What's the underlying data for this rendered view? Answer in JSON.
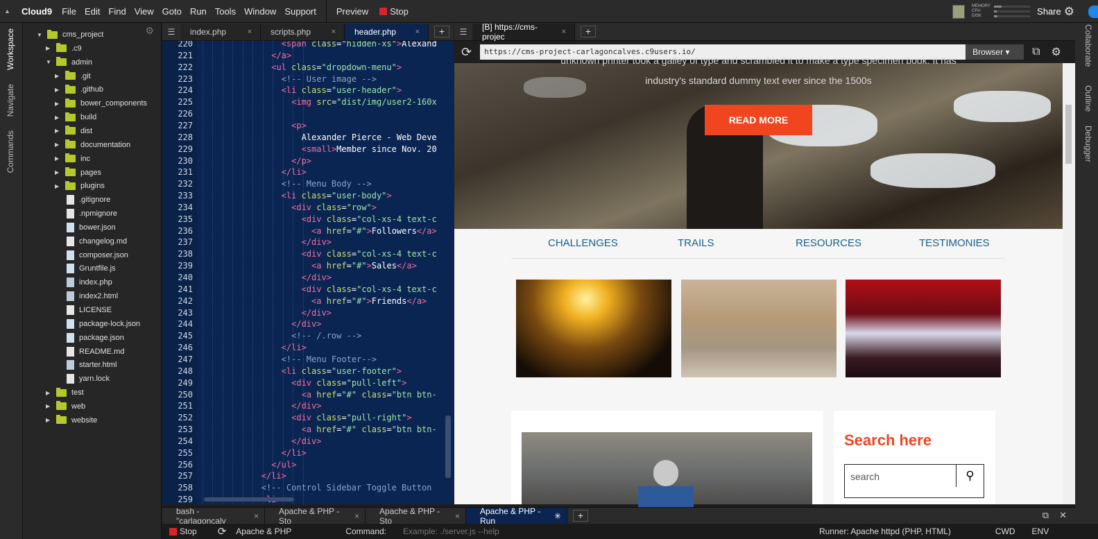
{
  "menubar": {
    "logo": "Cloud9",
    "items": [
      "File",
      "Edit",
      "Find",
      "View",
      "Goto",
      "Run",
      "Tools",
      "Window",
      "Support"
    ],
    "preview": "Preview",
    "stop": "Stop",
    "share": "Share",
    "meters": [
      "MEMORY",
      "CPU",
      "DISK"
    ],
    "meter_levels": [
      0.22,
      0.08,
      0.1
    ]
  },
  "left_side_tabs": [
    "Workspace",
    "Navigate",
    "Commands"
  ],
  "right_side_tabs": [
    "Collaborate",
    "Outline",
    "Debugger"
  ],
  "tree": [
    {
      "name": "cms_project",
      "kind": "folder",
      "open": true,
      "level": 0
    },
    {
      "name": ".c9",
      "kind": "folder",
      "open": false,
      "level": 1
    },
    {
      "name": "admin",
      "kind": "folder",
      "open": true,
      "level": 1
    },
    {
      "name": ".git",
      "kind": "folder",
      "open": false,
      "level": 2
    },
    {
      "name": ".github",
      "kind": "folder",
      "open": false,
      "level": 2
    },
    {
      "name": "bower_components",
      "kind": "folder",
      "open": false,
      "level": 2
    },
    {
      "name": "build",
      "kind": "folder",
      "open": false,
      "level": 2
    },
    {
      "name": "dist",
      "kind": "folder",
      "open": false,
      "level": 2
    },
    {
      "name": "documentation",
      "kind": "folder",
      "open": false,
      "level": 2
    },
    {
      "name": "inc",
      "kind": "folder",
      "open": false,
      "level": 2
    },
    {
      "name": "pages",
      "kind": "folder",
      "open": false,
      "level": 2
    },
    {
      "name": "plugins",
      "kind": "folder",
      "open": false,
      "level": 2
    },
    {
      "name": ".gitignore",
      "kind": "file",
      "level": 2
    },
    {
      "name": ".npmignore",
      "kind": "file",
      "level": 2
    },
    {
      "name": "bower.json",
      "kind": "js",
      "level": 2
    },
    {
      "name": "changelog.md",
      "kind": "file",
      "level": 2
    },
    {
      "name": "composer.json",
      "kind": "js",
      "level": 2
    },
    {
      "name": "Gruntfile.js",
      "kind": "js",
      "level": 2
    },
    {
      "name": "index.php",
      "kind": "html",
      "level": 2
    },
    {
      "name": "index2.html",
      "kind": "html",
      "level": 2
    },
    {
      "name": "LICENSE",
      "kind": "file",
      "level": 2
    },
    {
      "name": "package-lock.json",
      "kind": "js",
      "level": 2
    },
    {
      "name": "package.json",
      "kind": "js",
      "level": 2
    },
    {
      "name": "README.md",
      "kind": "file",
      "level": 2
    },
    {
      "name": "starter.html",
      "kind": "html",
      "level": 2
    },
    {
      "name": "yarn.lock",
      "kind": "file",
      "level": 2
    },
    {
      "name": "test",
      "kind": "folder",
      "open": false,
      "level": 1
    },
    {
      "name": "web",
      "kind": "folder",
      "open": false,
      "level": 1
    },
    {
      "name": "website",
      "kind": "folder",
      "open": false,
      "level": 1
    }
  ],
  "editor_tabs": [
    {
      "label": "index.php",
      "close": "×"
    },
    {
      "label": "scripts.php",
      "close": "×"
    },
    {
      "label": "header.php",
      "close": "×",
      "active": true
    }
  ],
  "code_lines": [
    {
      "n": "220",
      "indent": 8,
      "parts": [
        [
          "tg",
          "<span "
        ],
        [
          "at",
          "class"
        ],
        [
          "tx",
          "="
        ],
        [
          "st",
          "\"hidden-xs\""
        ],
        [
          "tg",
          ">"
        ],
        [
          "tx",
          "Alexand"
        ]
      ]
    },
    {
      "n": "221",
      "indent": 7,
      "parts": [
        [
          "tg",
          "</a>"
        ]
      ]
    },
    {
      "n": "222",
      "indent": 7,
      "parts": [
        [
          "tg",
          "<ul "
        ],
        [
          "at",
          "class"
        ],
        [
          "tx",
          "="
        ],
        [
          "st",
          "\"dropdown-menu\""
        ],
        [
          "tg",
          ">"
        ]
      ]
    },
    {
      "n": "223",
      "indent": 8,
      "parts": [
        [
          "cm",
          "<!-- User image -->"
        ]
      ]
    },
    {
      "n": "224",
      "indent": 8,
      "parts": [
        [
          "tg",
          "<li "
        ],
        [
          "at",
          "class"
        ],
        [
          "tx",
          "="
        ],
        [
          "st",
          "\"user-header\""
        ],
        [
          "tg",
          ">"
        ]
      ]
    },
    {
      "n": "225",
      "indent": 9,
      "parts": [
        [
          "tg",
          "<img "
        ],
        [
          "at",
          "src"
        ],
        [
          "tx",
          "="
        ],
        [
          "st",
          "\"dist/img/user2-160x"
        ]
      ]
    },
    {
      "n": "226",
      "indent": 0,
      "parts": []
    },
    {
      "n": "227",
      "indent": 9,
      "parts": [
        [
          "tg",
          "<p>"
        ]
      ]
    },
    {
      "n": "228",
      "indent": 10,
      "parts": [
        [
          "tx",
          "Alexander Pierce - Web Deve"
        ]
      ]
    },
    {
      "n": "229",
      "indent": 10,
      "parts": [
        [
          "tg",
          "<small>"
        ],
        [
          "tx",
          "Member since Nov. 20"
        ]
      ]
    },
    {
      "n": "230",
      "indent": 9,
      "parts": [
        [
          "tg",
          "</p>"
        ]
      ]
    },
    {
      "n": "231",
      "indent": 8,
      "parts": [
        [
          "tg",
          "</li>"
        ]
      ]
    },
    {
      "n": "232",
      "indent": 8,
      "parts": [
        [
          "cm",
          "<!-- Menu Body -->"
        ]
      ]
    },
    {
      "n": "233",
      "indent": 8,
      "parts": [
        [
          "tg",
          "<li "
        ],
        [
          "at",
          "class"
        ],
        [
          "tx",
          "="
        ],
        [
          "st",
          "\"user-body\""
        ],
        [
          "tg",
          ">"
        ]
      ]
    },
    {
      "n": "234",
      "indent": 9,
      "parts": [
        [
          "tg",
          "<div "
        ],
        [
          "at",
          "class"
        ],
        [
          "tx",
          "="
        ],
        [
          "st",
          "\"row\""
        ],
        [
          "tg",
          ">"
        ]
      ]
    },
    {
      "n": "235",
      "indent": 10,
      "parts": [
        [
          "tg",
          "<div "
        ],
        [
          "at",
          "class"
        ],
        [
          "tx",
          "="
        ],
        [
          "st",
          "\"col-xs-4 text-c"
        ]
      ]
    },
    {
      "n": "236",
      "indent": 11,
      "parts": [
        [
          "tg",
          "<a "
        ],
        [
          "at",
          "href"
        ],
        [
          "tx",
          "="
        ],
        [
          "st",
          "\"#\""
        ],
        [
          "tg",
          ">"
        ],
        [
          "tx",
          "Followers"
        ],
        [
          "tg",
          "</a>"
        ]
      ]
    },
    {
      "n": "237",
      "indent": 10,
      "parts": [
        [
          "tg",
          "</div>"
        ]
      ]
    },
    {
      "n": "238",
      "indent": 10,
      "parts": [
        [
          "tg",
          "<div "
        ],
        [
          "at",
          "class"
        ],
        [
          "tx",
          "="
        ],
        [
          "st",
          "\"col-xs-4 text-c"
        ]
      ]
    },
    {
      "n": "239",
      "indent": 11,
      "parts": [
        [
          "tg",
          "<a "
        ],
        [
          "at",
          "href"
        ],
        [
          "tx",
          "="
        ],
        [
          "st",
          "\"#\""
        ],
        [
          "tg",
          ">"
        ],
        [
          "tx",
          "Sales"
        ],
        [
          "tg",
          "</a>"
        ]
      ]
    },
    {
      "n": "240",
      "indent": 10,
      "parts": [
        [
          "tg",
          "</div>"
        ]
      ]
    },
    {
      "n": "241",
      "indent": 10,
      "parts": [
        [
          "tg",
          "<div "
        ],
        [
          "at",
          "class"
        ],
        [
          "tx",
          "="
        ],
        [
          "st",
          "\"col-xs-4 text-c"
        ]
      ]
    },
    {
      "n": "242",
      "indent": 11,
      "parts": [
        [
          "tg",
          "<a "
        ],
        [
          "at",
          "href"
        ],
        [
          "tx",
          "="
        ],
        [
          "st",
          "\"#\""
        ],
        [
          "tg",
          ">"
        ],
        [
          "tx",
          "Friends"
        ],
        [
          "tg",
          "</a>"
        ]
      ]
    },
    {
      "n": "243",
      "indent": 10,
      "parts": [
        [
          "tg",
          "</div>"
        ]
      ]
    },
    {
      "n": "244",
      "indent": 9,
      "parts": [
        [
          "tg",
          "</div>"
        ]
      ]
    },
    {
      "n": "245",
      "indent": 9,
      "parts": [
        [
          "cm",
          "<!-- /.row -->"
        ]
      ]
    },
    {
      "n": "246",
      "indent": 8,
      "parts": [
        [
          "tg",
          "</li>"
        ]
      ]
    },
    {
      "n": "247",
      "indent": 8,
      "parts": [
        [
          "cm",
          "<!-- Menu Footer-->"
        ]
      ]
    },
    {
      "n": "248",
      "indent": 8,
      "parts": [
        [
          "tg",
          "<li "
        ],
        [
          "at",
          "class"
        ],
        [
          "tx",
          "="
        ],
        [
          "st",
          "\"user-footer\""
        ],
        [
          "tg",
          ">"
        ]
      ]
    },
    {
      "n": "249",
      "indent": 9,
      "parts": [
        [
          "tg",
          "<div "
        ],
        [
          "at",
          "class"
        ],
        [
          "tx",
          "="
        ],
        [
          "st",
          "\"pull-left\""
        ],
        [
          "tg",
          ">"
        ]
      ]
    },
    {
      "n": "250",
      "indent": 10,
      "parts": [
        [
          "tg",
          "<a "
        ],
        [
          "at",
          "href"
        ],
        [
          "tx",
          "="
        ],
        [
          "st",
          "\"#\""
        ],
        [
          "tx",
          " "
        ],
        [
          "at",
          "class"
        ],
        [
          "tx",
          "="
        ],
        [
          "st",
          "\"btn btn-"
        ]
      ]
    },
    {
      "n": "251",
      "indent": 9,
      "parts": [
        [
          "tg",
          "</div>"
        ]
      ]
    },
    {
      "n": "252",
      "indent": 9,
      "parts": [
        [
          "tg",
          "<div "
        ],
        [
          "at",
          "class"
        ],
        [
          "tx",
          "="
        ],
        [
          "st",
          "\"pull-right\""
        ],
        [
          "tg",
          ">"
        ]
      ]
    },
    {
      "n": "253",
      "indent": 10,
      "parts": [
        [
          "tg",
          "<a "
        ],
        [
          "at",
          "href"
        ],
        [
          "tx",
          "="
        ],
        [
          "st",
          "\"#\""
        ],
        [
          "tx",
          " "
        ],
        [
          "at",
          "class"
        ],
        [
          "tx",
          "="
        ],
        [
          "st",
          "\"btn btn-"
        ]
      ]
    },
    {
      "n": "254",
      "indent": 9,
      "parts": [
        [
          "tg",
          "</div>"
        ]
      ]
    },
    {
      "n": "255",
      "indent": 8,
      "parts": [
        [
          "tg",
          "</li>"
        ]
      ]
    },
    {
      "n": "256",
      "indent": 7,
      "parts": [
        [
          "tg",
          "</ul>"
        ]
      ]
    },
    {
      "n": "257",
      "indent": 6,
      "parts": [
        [
          "tg",
          "</li>"
        ]
      ]
    },
    {
      "n": "258",
      "indent": 6,
      "parts": [
        [
          "cm",
          "<!-- Control Sidebar Toggle Button"
        ]
      ]
    },
    {
      "n": "259",
      "indent": 6,
      "parts": [
        [
          "tg",
          "<li>"
        ]
      ]
    }
  ],
  "preview": {
    "tab_label": "[B] https://cms-projec",
    "tab_close": "×",
    "url": "https://cms-project-carlagoncalves.c9users.io/",
    "browser_label": "Browser ▾",
    "hero_text_1": "unknown printer took a galley of type and scrambled it to make a type specimen book. It has",
    "hero_text_2": "industry's standard dummy text ever since the 1500s",
    "read_more": "READ MORE",
    "nav": [
      "CHALLENGES",
      "TRAILS",
      "RESOURCES",
      "TESTIMONIES"
    ],
    "search_title": "Search here",
    "search_placeholder": "search"
  },
  "bottom_tabs": [
    {
      "label": "bash - \"carlagoncalv",
      "close": "×"
    },
    {
      "label": "Apache & PHP - Sto",
      "close": "×"
    },
    {
      "label": "Apache & PHP - Sto",
      "close": "×"
    },
    {
      "label": "Apache & PHP - Run",
      "close": "",
      "active": true
    }
  ],
  "status": {
    "stop": "Stop",
    "runner_name": "Apache & PHP",
    "command_label": "Command:",
    "command_placeholder": "Example: ./server.js --help",
    "runner": "Runner: Apache httpd (PHP, HTML)",
    "cwd": "CWD",
    "env": "ENV"
  }
}
